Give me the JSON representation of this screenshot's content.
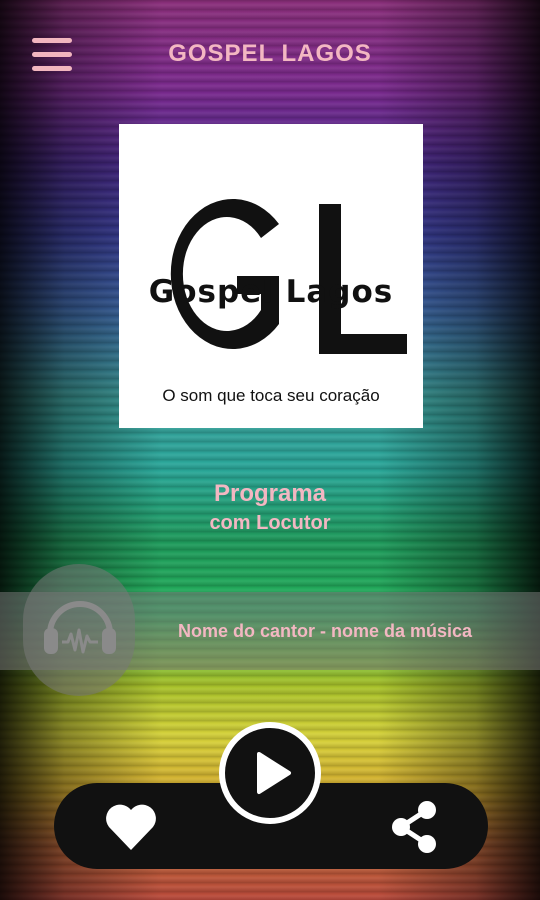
{
  "header": {
    "title": "GOSPEL LAGOS",
    "menu_icon": "hamburger-menu-icon"
  },
  "logo": {
    "monogram": "GL",
    "brand": "Gospel Lagos",
    "slogan": "O som que toca seu coração"
  },
  "program": {
    "name": "Programa",
    "host": "com Locutor"
  },
  "now_playing": {
    "icon": "headphones-icon",
    "text": "Nome do cantor - nome da música"
  },
  "controls": {
    "favorite_icon": "heart-icon",
    "play_icon": "play-icon",
    "share_icon": "share-icon"
  },
  "colors": {
    "accent_text": "#f3b7c2",
    "control_bg": "#111111",
    "control_fg": "#ffffff"
  }
}
